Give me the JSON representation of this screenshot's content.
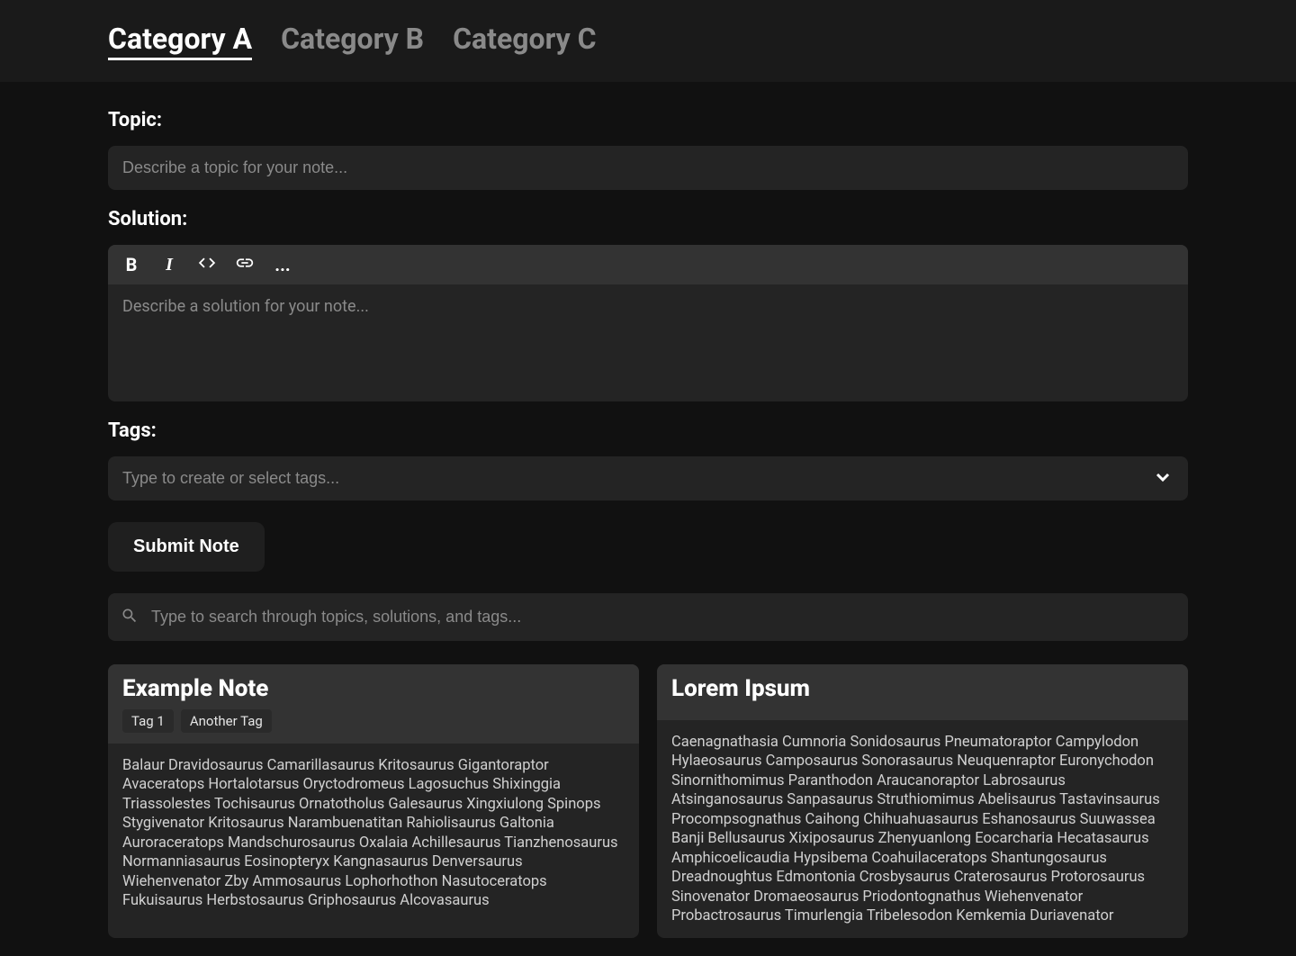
{
  "tabs": [
    {
      "label": "Category A",
      "active": true
    },
    {
      "label": "Category B",
      "active": false
    },
    {
      "label": "Category C",
      "active": false
    }
  ],
  "topic": {
    "label": "Topic:",
    "placeholder": "Describe a topic for your note..."
  },
  "solution": {
    "label": "Solution:",
    "placeholder": "Describe a solution for your note..."
  },
  "tags": {
    "label": "Tags:",
    "placeholder": "Type to create or select tags..."
  },
  "submit_label": "Submit Note",
  "search": {
    "placeholder": "Type to search through topics, solutions, and tags..."
  },
  "toolbar": {
    "bold": "B",
    "italic": "I",
    "more": "..."
  },
  "notes": [
    {
      "title": "Example Note",
      "tags": [
        "Tag 1",
        "Another Tag"
      ],
      "body": "Balaur Dravidosaurus Camarillasaurus Kritosaurus Gigantoraptor Avaceratops Hortalotarsus Oryctodromeus Lagosuchus Shixinggia Triassolestes Tochisaurus Ornatotholus Galesaurus Xingxiulong Spinops Stygivenator Kritosaurus Narambuenatitan Rahiolisaurus Galtonia Auroraceratops Mandschurosaurus Oxalaia Achillesaurus Tianzhenosaurus Normanniasaurus Eosinopteryx Kangnasaurus Denversaurus Wiehenvenator Zby Ammosaurus Lophorhothon Nasutoceratops Fukuisaurus Herbstosaurus Griphosaurus Alcovasaurus"
    },
    {
      "title": "Lorem Ipsum",
      "tags": [],
      "body": "Caenagnathasia Cumnoria Sonidosaurus Pneumatoraptor Campylodon Hylaeosaurus Camposaurus Sonorasaurus Neuquenraptor Euronychodon Sinornithomimus Paranthodon Araucanoraptor Labrosaurus Atsinganosaurus Sanpasaurus Struthiomimus Abelisaurus Tastavinsaurus Procompsognathus Caihong Chihuahuasaurus Eshanosaurus Suuwassea Banji Bellusaurus Xixiposaurus Zhenyuanlong Eocarcharia Hecatasaurus Amphicoelicaudia Hypsibema Coahuilaceratops Shantungosaurus Dreadnoughtus Edmontonia Crosbysaurus Craterosaurus Protorosaurus Sinovenator Dromaeosaurus Priodontognathus Wiehenvenator Probactrosaurus Timurlengia Tribelesodon Kemkemia Duriavenator"
    }
  ]
}
